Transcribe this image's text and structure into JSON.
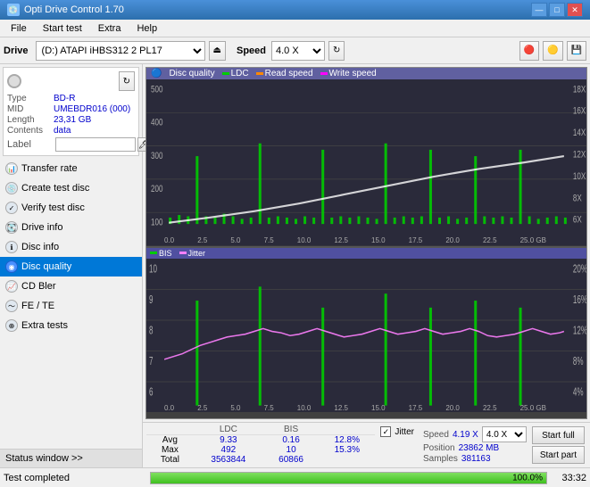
{
  "app": {
    "title": "Opti Drive Control 1.70",
    "icon": "📀"
  },
  "titlebar": {
    "minimize": "—",
    "maximize": "□",
    "close": "✕"
  },
  "menubar": {
    "items": [
      "File",
      "Start test",
      "Extra",
      "Help"
    ]
  },
  "toolbar": {
    "drive_label": "Drive",
    "drive_value": "(D:) ATAPI iHBS312  2 PL17",
    "speed_label": "Speed",
    "speed_value": "4.0 X"
  },
  "disc": {
    "type_label": "Type",
    "type_value": "BD-R",
    "mid_label": "MID",
    "mid_value": "UMEBDR016 (000)",
    "length_label": "Length",
    "length_value": "23,31 GB",
    "contents_label": "Contents",
    "contents_value": "data",
    "label_label": "Label",
    "label_placeholder": ""
  },
  "nav": {
    "items": [
      {
        "id": "transfer-rate",
        "label": "Transfer rate"
      },
      {
        "id": "create-test-disc",
        "label": "Create test disc"
      },
      {
        "id": "verify-test-disc",
        "label": "Verify test disc"
      },
      {
        "id": "drive-info",
        "label": "Drive info"
      },
      {
        "id": "disc-info",
        "label": "Disc info"
      },
      {
        "id": "disc-quality",
        "label": "Disc quality",
        "active": true
      },
      {
        "id": "cd-bler",
        "label": "CD Bler"
      },
      {
        "id": "fe-te",
        "label": "FE / TE"
      },
      {
        "id": "extra-tests",
        "label": "Extra tests"
      }
    ],
    "status_window": "Status window >>"
  },
  "chart": {
    "title": "Disc quality",
    "legend": [
      {
        "label": "LDC",
        "color": "#00cc00"
      },
      {
        "label": "Read speed",
        "color": "#ff8800"
      },
      {
        "label": "Write speed",
        "color": "#ff00ff"
      }
    ],
    "legend_bottom": [
      {
        "label": "BIS",
        "color": "#00cc00"
      },
      {
        "label": "Jitter",
        "color": "#ff80ff"
      }
    ],
    "top_y_max": 500,
    "top_y_right_max": "18X",
    "bottom_y_max": 10,
    "bottom_y_right_max": "20%",
    "x_labels": [
      "0.0",
      "2.5",
      "5.0",
      "7.5",
      "10.0",
      "12.5",
      "15.0",
      "17.5",
      "20.0",
      "22.5",
      "25.0 GB"
    ]
  },
  "stats": {
    "columns": [
      "",
      "LDC",
      "BIS",
      "",
      "Jitter",
      "Speed"
    ],
    "avg_label": "Avg",
    "max_label": "Max",
    "total_label": "Total",
    "ldc_avg": "9.33",
    "ldc_max": "492",
    "ldc_total": "3563844",
    "bis_avg": "0.16",
    "bis_max": "10",
    "bis_total": "60866",
    "jitter_avg": "12.8%",
    "jitter_max": "15.3%",
    "jitter_checked": true,
    "speed_label": "Speed",
    "speed_value": "4.19 X",
    "speed_select": "4.0 X",
    "position_label": "Position",
    "position_value": "23862 MB",
    "samples_label": "Samples",
    "samples_value": "381163"
  },
  "buttons": {
    "start_full": "Start full",
    "start_part": "Start part"
  },
  "statusbar": {
    "text": "Test completed",
    "progress": 100,
    "progress_text": "100.0%",
    "time": "33:32"
  }
}
